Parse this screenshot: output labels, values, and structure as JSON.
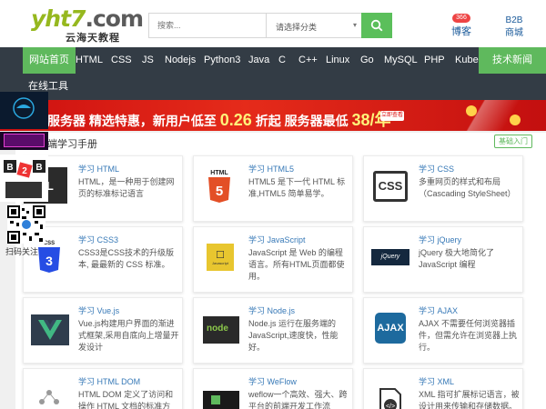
{
  "header": {
    "logo_main": "yht7",
    "logo_dotcom": ".com",
    "logo_sub": "云海天教程",
    "search_placeholder": "搜索...",
    "search_category": "请选择分类",
    "blog_label": "博客",
    "blog_badge": "366",
    "b2b_line1": "B2B",
    "b2b_line2": "商城"
  },
  "nav": {
    "items": [
      "网站首页",
      "HTML",
      "CSS",
      "JS",
      "Nodejs",
      "Python3",
      "Java",
      "C",
      "C++",
      "Linux",
      "Go",
      "MySQL",
      "PHP",
      "Kuber"
    ],
    "right_item": "技术新闻",
    "row2_item": "在线工具"
  },
  "banner": {
    "text_a": "服务器 精选特惠，新用户低至 ",
    "text_big1": "0.26",
    "text_b": " 折起 服务器最低 ",
    "text_big2": "38/年",
    "tag": "立即查看"
  },
  "section": {
    "title": "端学习手册",
    "beginner": "基础入门"
  },
  "cards": [
    {
      "title": "学习 HTML",
      "desc": "HTML，是一种用于创建网页的标准标记语言",
      "icon": "html-icon"
    },
    {
      "title": "学习 HTML5",
      "desc": "HTML5 是下一代 HTML 标准,HTML5 简单易学。",
      "icon": "html5-icon"
    },
    {
      "title": "学习 CSS",
      "desc": "多重网页的样式和布局（Cascading StyleSheet）",
      "icon": "css-icon"
    },
    {
      "title": "学习 CSS3",
      "desc": "CSS3是CSS技术的升级版本, 最最新的 CSS 标准。",
      "icon": "css3-icon"
    },
    {
      "title": "学习 JavaScript",
      "desc": "JavaScript 是 Web 的编程语言。所有HTML页面都使用。",
      "icon": "javascript-icon"
    },
    {
      "title": "学习 jQuery",
      "desc": "jQuery 极大地简化了 JavaScript 编程",
      "icon": "jquery-icon"
    },
    {
      "title": "学习 Vue.js",
      "desc": "Vue.js构建用户界面的渐进式框架,采用自底向上增量开发设计",
      "icon": "vue-icon"
    },
    {
      "title": "学习 Node.js",
      "desc": "Node.js 运行在服务端的 JavaScript,速度快，性能好。",
      "icon": "nodejs-icon"
    },
    {
      "title": "学习 AJAX",
      "desc": "AJAX 不需要任何浏览器插件，但需允许在浏览器上执行。",
      "icon": "ajax-icon"
    },
    {
      "title": "学习 HTML DOM",
      "desc": "HTML DOM 定义了访问和操作 HTML 文档的标准方法。",
      "icon": "dom-icon"
    },
    {
      "title": "学习 WeFlow",
      "desc": "weflow一个高效、强大、跨平台的前端开发工作流",
      "icon": "weflow-icon"
    },
    {
      "title": "学习 XML",
      "desc": "XML 指可扩展标记语言，被设计用来传输和存储数据。",
      "icon": "xml-icon"
    }
  ],
  "sidebar": {
    "qr_label": "扫码关注"
  },
  "colors": {
    "brand_green": "#5fb95d",
    "nav_bg": "#333c45",
    "link_blue": "#3779b7",
    "banner_red": "#e52b1a"
  }
}
